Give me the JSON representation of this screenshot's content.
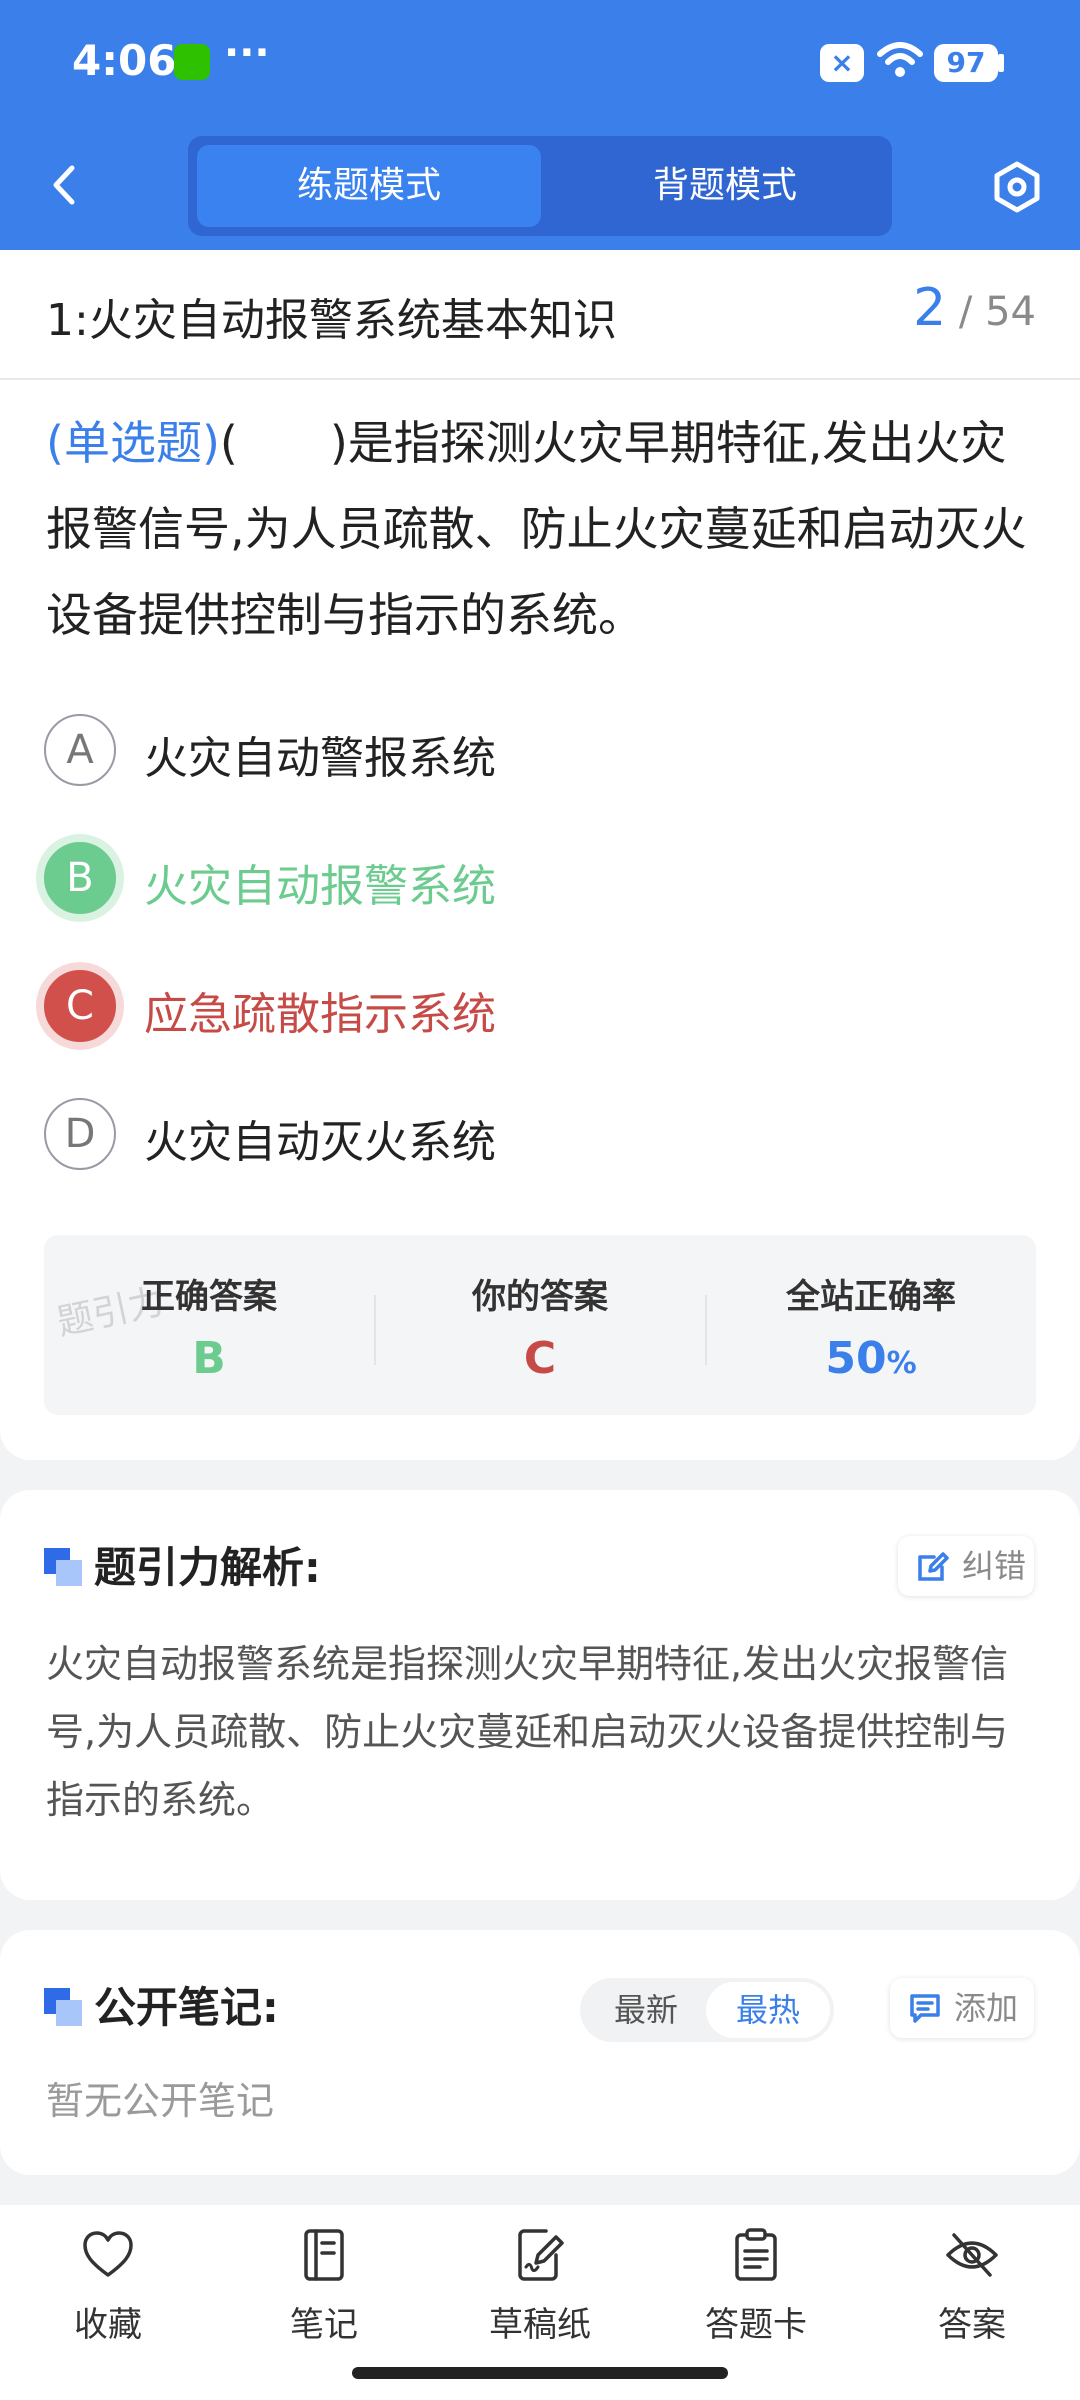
{
  "status_bar": {
    "time": "4:06",
    "dots": "···",
    "battery": "97"
  },
  "header": {
    "tabs": [
      {
        "label": "练题模式",
        "active": true
      },
      {
        "label": "背题模式",
        "active": false
      }
    ]
  },
  "chapter": {
    "title": "1:火灾自动报警系统基本知识",
    "current": "2",
    "total": "54",
    "separator": "/"
  },
  "question": {
    "type": "(单选题)",
    "text": "(　　)是指探测火灾早期特征,发出火灾报警信号,为人员疏散、防止火灾蔓延和启动灭火设备提供控制与指示的系统。"
  },
  "options": [
    {
      "letter": "A",
      "text": "火灾自动警报系统",
      "state": "normal"
    },
    {
      "letter": "B",
      "text": "火灾自动报警系统",
      "state": "correct"
    },
    {
      "letter": "C",
      "text": "应急疏散指示系统",
      "state": "wrong"
    },
    {
      "letter": "D",
      "text": "火灾自动灭火系统",
      "state": "normal"
    }
  ],
  "answer_summary": {
    "correct_label": "正确答案",
    "correct_value": "B",
    "yours_label": "你的答案",
    "yours_value": "C",
    "rate_label": "全站正确率",
    "rate_value": "50",
    "rate_unit": "%",
    "watermark": "题引力"
  },
  "analysis": {
    "title": "题引力解析:",
    "report_label": "纠错",
    "text": "火灾自动报警系统是指探测火灾早期特征,发出火灾报警信号,为人员疏散、防止火灾蔓延和启动灭火设备提供控制与指示的系统。"
  },
  "notes": {
    "title": "公开笔记:",
    "sort_newest": "最新",
    "sort_hottest": "最热",
    "add_label": "添加",
    "empty_text": "暂无公开笔记"
  },
  "bottom_bar": [
    {
      "label": "收藏",
      "icon": "heart-icon"
    },
    {
      "label": "笔记",
      "icon": "notebook-icon"
    },
    {
      "label": "草稿纸",
      "icon": "draft-icon"
    },
    {
      "label": "答题卡",
      "icon": "answer-card-icon"
    },
    {
      "label": "答案",
      "icon": "eye-off-icon"
    }
  ],
  "colors": {
    "primary": "#3A7FEA",
    "correct": "#6CCB8E",
    "wrong": "#D2504C"
  }
}
